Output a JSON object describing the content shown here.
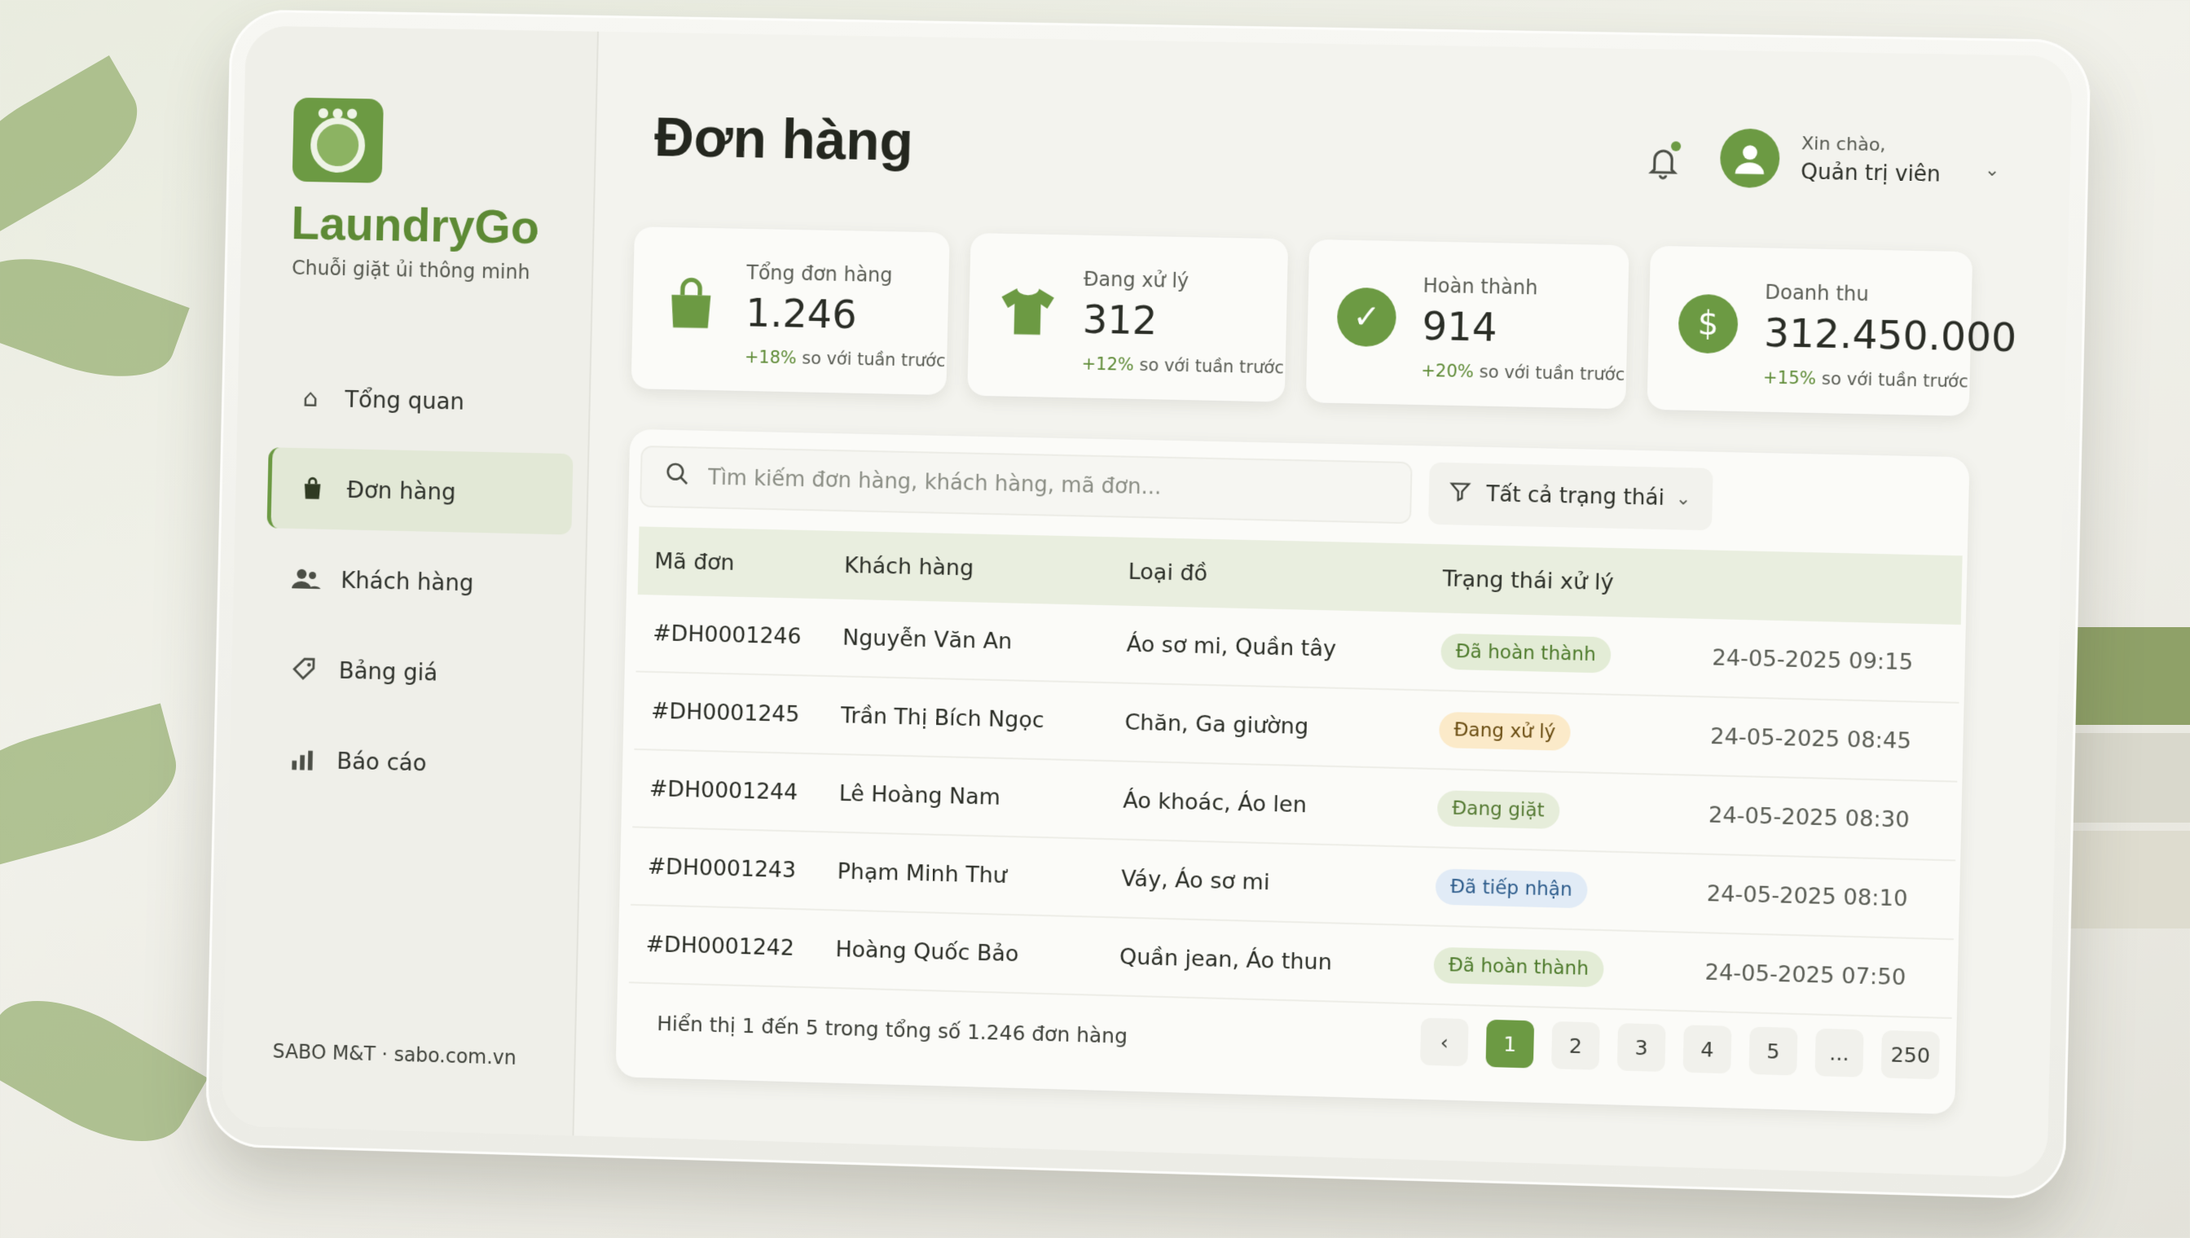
{
  "app": {
    "name": "LaundryGo",
    "tagline": "Chuỗi giặt ủi thông minh",
    "footer": "SABO M&T · sabo.com.vn",
    "accent": "#6c9a43"
  },
  "sidebar": {
    "items": [
      {
        "label": "Tổng quan",
        "icon": "home-icon"
      },
      {
        "label": "Đơn hàng",
        "icon": "shopping-bag-icon",
        "active": true
      },
      {
        "label": "Khách hàng",
        "icon": "users-icon"
      },
      {
        "label": "Bảng giá",
        "icon": "price-tag-icon"
      },
      {
        "label": "Báo cáo",
        "icon": "bar-chart-icon"
      }
    ]
  },
  "header": {
    "title": "Đơn hàng",
    "greeting": "Xin chào,",
    "user_role": "Quản trị viên"
  },
  "stats": [
    {
      "label": "Tổng đơn hàng",
      "value": "1.246",
      "delta": "+18%",
      "delta_text": " so với tuần trước",
      "icon": "shopping-bag-icon"
    },
    {
      "label": "Đang xử lý",
      "value": "312",
      "delta": "+12%",
      "delta_text": " so với tuần trước",
      "icon": "shirt-icon"
    },
    {
      "label": "Hoàn thành",
      "value": "914",
      "delta": "+20%",
      "delta_text": " so với tuần trước",
      "icon": "check-circle-icon"
    },
    {
      "label": "Doanh thu",
      "value": "312.450.000",
      "delta": "+15%",
      "delta_text": " so với tuần trước",
      "icon": "dollar-icon"
    }
  ],
  "search": {
    "placeholder": "Tìm kiếm đơn hàng, khách hàng, mã đơn..."
  },
  "filter": {
    "label": "Tất cả trạng thái"
  },
  "table": {
    "columns": [
      "Mã đơn",
      "Khách hàng",
      "Loại đồ",
      "Trạng thái xử lý"
    ],
    "rows": [
      {
        "id": "#DH0001246",
        "customer": "Nguyễn Văn An",
        "items": "Áo sơ mi, Quần tây",
        "status": "Đã hoàn thành",
        "time": "24-05-2025 09:15"
      },
      {
        "id": "#DH0001245",
        "customer": "Trần Thị Bích Ngọc",
        "items": "Chăn, Ga giường",
        "status": "Đang xử lý",
        "time": "24-05-2025 08:45"
      },
      {
        "id": "#DH0001244",
        "customer": "Lê Hoàng Nam",
        "items": "Áo khoác, Áo len",
        "status": "Đang giặt",
        "time": "24-05-2025 08:30"
      },
      {
        "id": "#DH0001243",
        "customer": "Phạm Minh Thư",
        "items": "Váy, Áo sơ mi",
        "status": "Đã tiếp nhận",
        "time": "24-05-2025 08:10"
      },
      {
        "id": "#DH0001242",
        "customer": "Hoàng Quốc Bảo",
        "items": "Quần jean, Áo thun",
        "status": "Đã hoàn thành",
        "time": "24-05-2025 07:50"
      }
    ]
  },
  "pagination": {
    "summary": "Hiển thị 1 đến 5 trong tổng số 1.246 đơn hàng",
    "pages": [
      "1",
      "2",
      "3",
      "4",
      "5",
      "...",
      "250"
    ],
    "current": "1",
    "prev": "‹",
    "next": "›"
  }
}
